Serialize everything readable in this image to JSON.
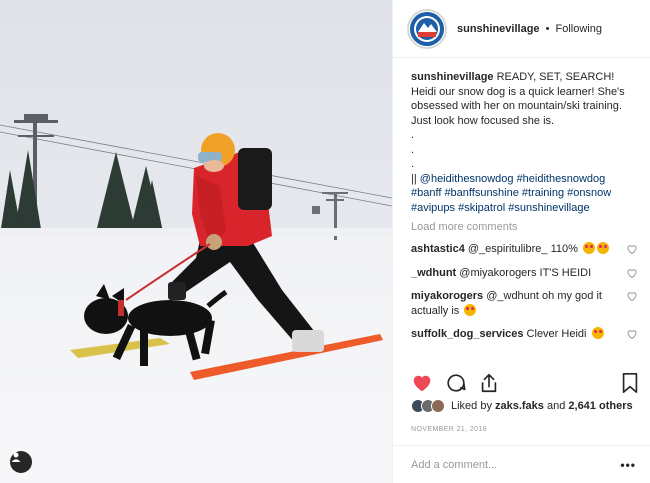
{
  "header": {
    "username": "sunshinevillage",
    "separator": "•",
    "follow_status": "Following",
    "avatar_text_top": "SUNSHINE",
    "avatar_text_bottom": "VILLAGE"
  },
  "caption": {
    "username": "sunshinevillage",
    "lines": [
      " READY, SET, SEARCH!",
      "Heidi our snow dog is a quick learner! She's",
      "obsessed with her on mountain/ski training.",
      "Just look how focused she is.",
      ".",
      ".",
      "."
    ],
    "tag_prefix": "|| ",
    "tags_line1": "@heidithesnowdog #heidithesnowdog",
    "tags_line2": "#banff #banffsunshine #training #onsnow",
    "tags_line3": "#avipups #skipatrol #sunshinevillage"
  },
  "load_more": "Load more comments",
  "comments": [
    {
      "user": "ashtastic4",
      "text": " @_espiritulibre_ 110%"
    },
    {
      "user": "_wdhunt",
      "text": " @miyakorogers IT'S HEIDI"
    },
    {
      "user": "miyakorogers",
      "text": " @_wdhunt oh my god it actually is"
    },
    {
      "user": "suffolk_dog_services",
      "text": " Clever Heidi"
    }
  ],
  "actions": {
    "like_icon": "heart-filled-icon",
    "comment_icon": "comment-icon",
    "share_icon": "share-icon",
    "save_icon": "bookmark-icon",
    "like_color": "#ed4956"
  },
  "likes": {
    "prefix": "Liked by ",
    "user": "zaks.faks",
    "middle": " and ",
    "count": "2,641 others"
  },
  "date": "NOVEMBER 21, 2018",
  "add_comment": {
    "placeholder": "Add a comment...",
    "more_label": "•••"
  }
}
